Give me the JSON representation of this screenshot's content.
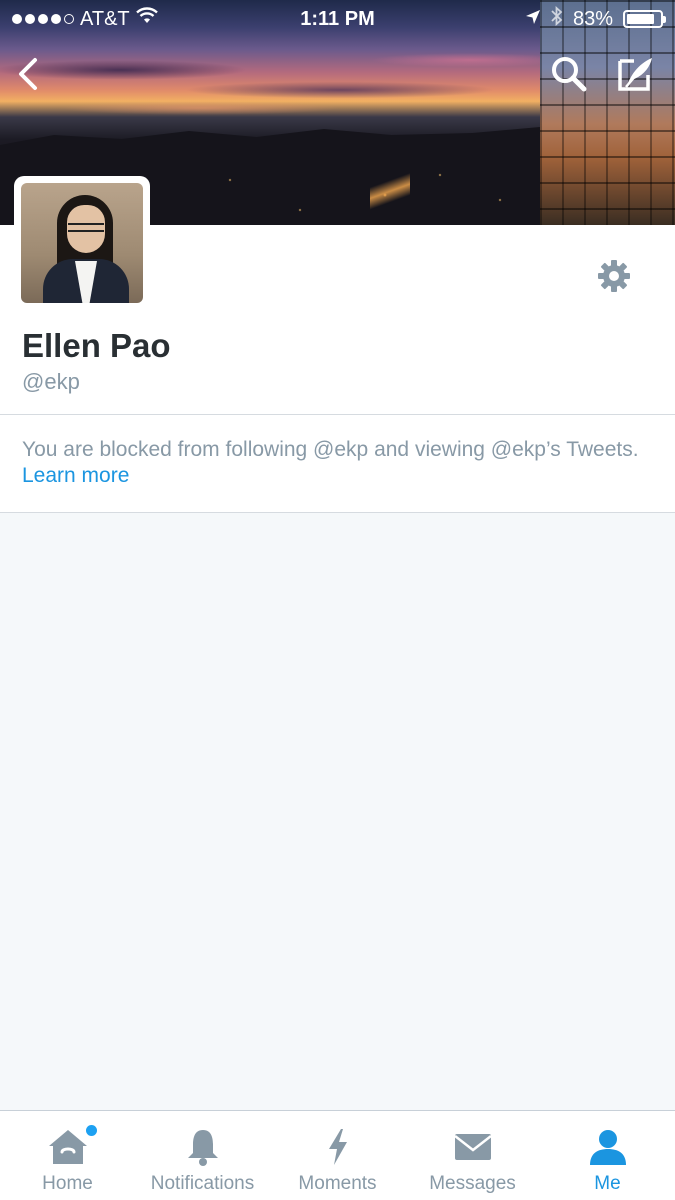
{
  "status_bar": {
    "carrier": "AT&T",
    "time": "1:11 PM",
    "battery": "83%",
    "battery_level": 0.83,
    "signal_bars_filled": 4,
    "signal_bars_total": 5
  },
  "header": {
    "back_icon": "chevron-left-icon",
    "search_icon": "search-icon",
    "compose_icon": "compose-tweet-icon"
  },
  "profile": {
    "name": "Ellen Pao",
    "handle": "@ekp",
    "settings_icon": "gear-icon"
  },
  "notice": {
    "text": "You are blocked from following @ekp and viewing @ekp’s Tweets. ",
    "link": "Learn more"
  },
  "tabbar": {
    "tabs": [
      {
        "label": "Home",
        "icon": "home-icon",
        "active": false,
        "has_dot": true
      },
      {
        "label": "Notifications",
        "icon": "bell-icon",
        "active": false
      },
      {
        "label": "Moments",
        "icon": "lightning-icon",
        "active": false
      },
      {
        "label": "Messages",
        "icon": "envelope-icon",
        "active": false
      },
      {
        "label": "Me",
        "icon": "person-icon",
        "active": true
      }
    ]
  },
  "colors": {
    "accent": "#1b95e0",
    "muted": "#8899a6",
    "name": "#292f33",
    "background": "#f5f8fa"
  }
}
